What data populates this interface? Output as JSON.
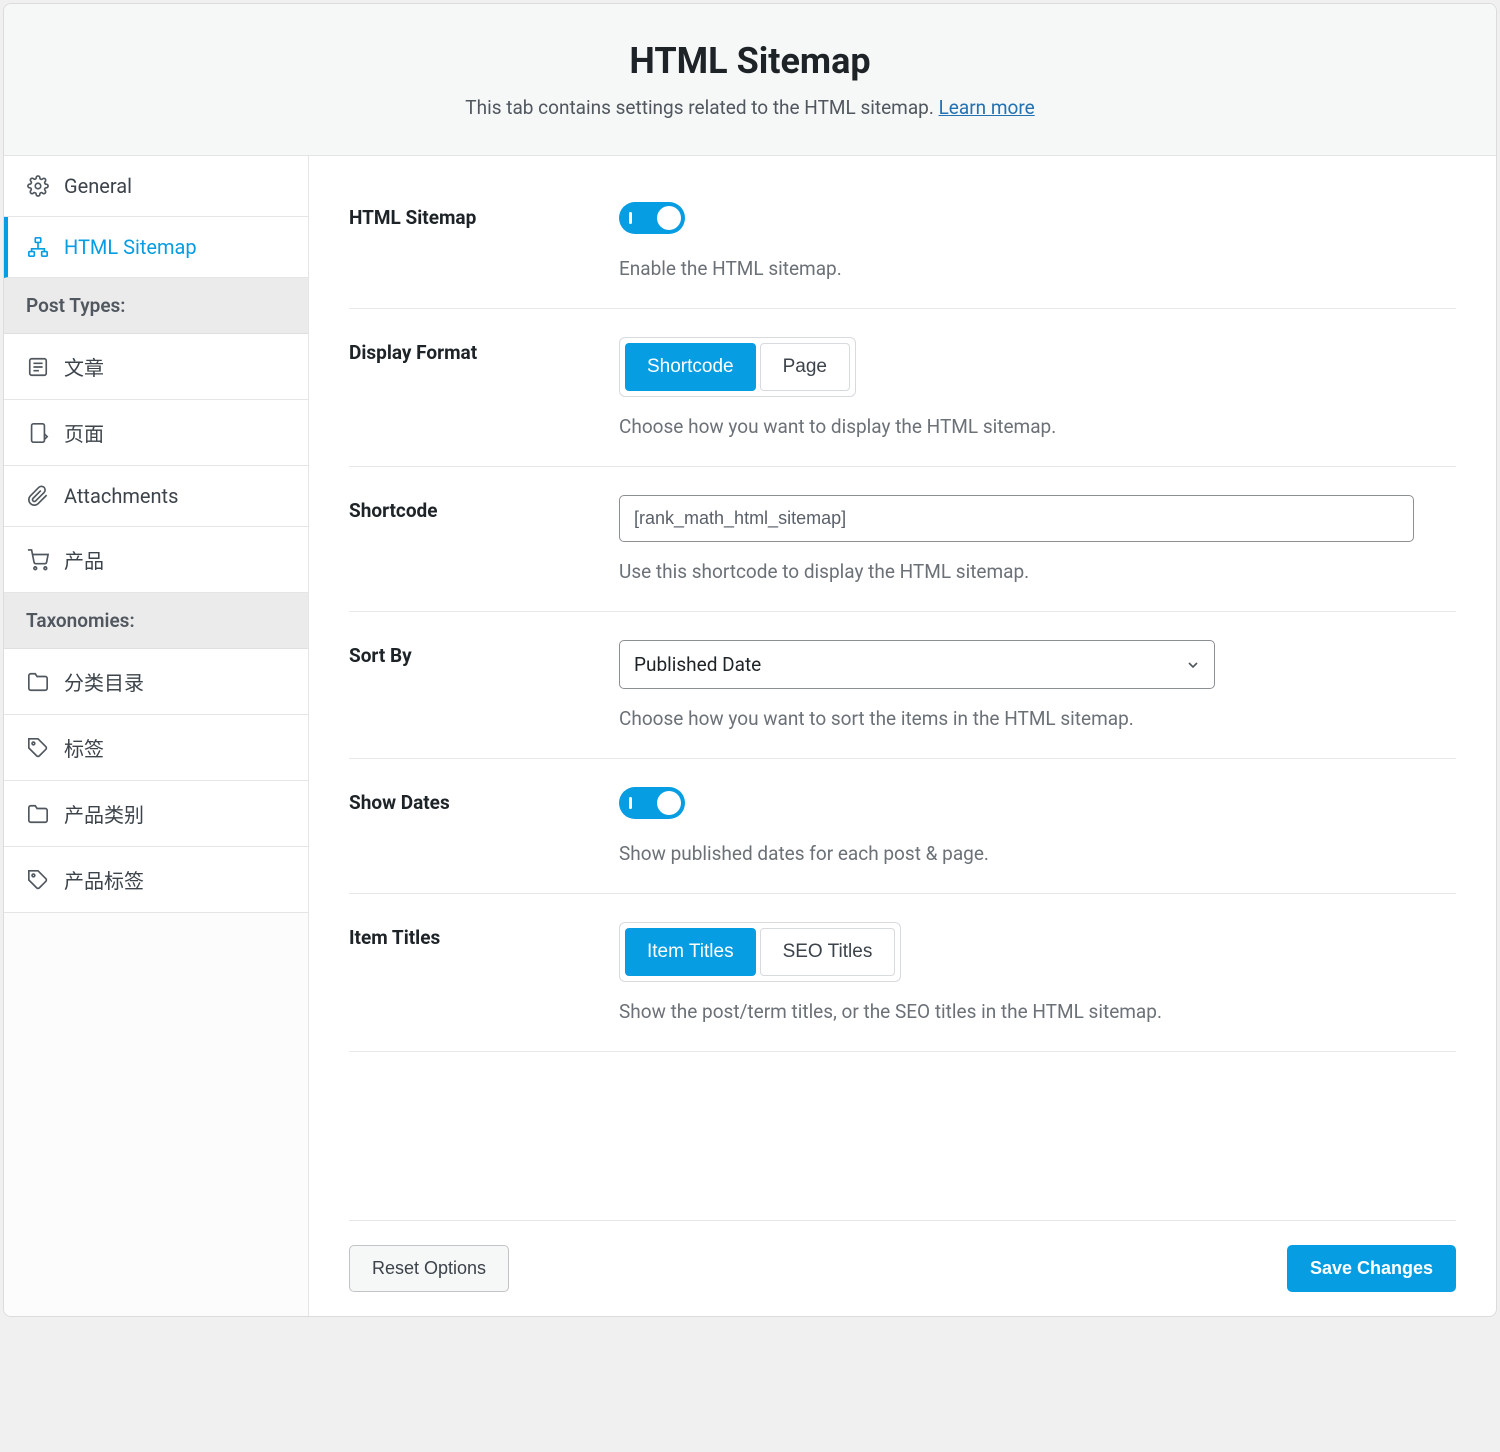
{
  "header": {
    "title": "HTML Sitemap",
    "subtitle": "This tab contains settings related to the HTML sitemap. ",
    "learn_more": "Learn more"
  },
  "sidebar": {
    "items_top": [
      {
        "label": "General",
        "icon": "gear"
      },
      {
        "label": "HTML Sitemap",
        "icon": "sitemap",
        "active": true
      }
    ],
    "group_post_types": "Post Types:",
    "items_post_types": [
      {
        "label": "文章",
        "icon": "post"
      },
      {
        "label": "页面",
        "icon": "page"
      },
      {
        "label": "Attachments",
        "icon": "clip"
      },
      {
        "label": "产品",
        "icon": "cart"
      }
    ],
    "group_taxonomies": "Taxonomies:",
    "items_taxonomies": [
      {
        "label": "分类目录",
        "icon": "folder"
      },
      {
        "label": "标签",
        "icon": "tag"
      },
      {
        "label": "产品类别",
        "icon": "folder"
      },
      {
        "label": "产品标签",
        "icon": "tag"
      }
    ]
  },
  "settings": {
    "html_sitemap": {
      "label": "HTML Sitemap",
      "enabled": true,
      "desc": "Enable the HTML sitemap."
    },
    "display_format": {
      "label": "Display Format",
      "options": [
        "Shortcode",
        "Page"
      ],
      "selected": "Shortcode",
      "desc": "Choose how you want to display the HTML sitemap."
    },
    "shortcode": {
      "label": "Shortcode",
      "value": "[rank_math_html_sitemap]",
      "desc": "Use this shortcode to display the HTML sitemap."
    },
    "sort_by": {
      "label": "Sort By",
      "value": "Published Date",
      "desc": "Choose how you want to sort the items in the HTML sitemap."
    },
    "show_dates": {
      "label": "Show Dates",
      "enabled": true,
      "desc": "Show published dates for each post & page."
    },
    "item_titles": {
      "label": "Item Titles",
      "options": [
        "Item Titles",
        "SEO Titles"
      ],
      "selected": "Item Titles",
      "desc": "Show the post/term titles, or the SEO titles in the HTML sitemap."
    }
  },
  "footer": {
    "reset": "Reset Options",
    "save": "Save Changes"
  }
}
